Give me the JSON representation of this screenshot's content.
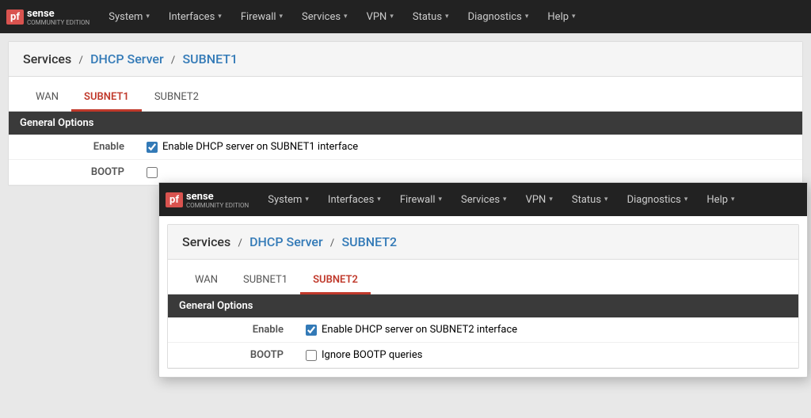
{
  "brand": {
    "pf": "pf",
    "sense": "sense",
    "sub": "COMMUNITY EDITION"
  },
  "nav": {
    "items": [
      {
        "label": "System",
        "has_arrow": true
      },
      {
        "label": "Interfaces",
        "has_arrow": true
      },
      {
        "label": "Firewall",
        "has_arrow": true
      },
      {
        "label": "Services",
        "has_arrow": true
      },
      {
        "label": "VPN",
        "has_arrow": true
      },
      {
        "label": "Status",
        "has_arrow": true
      },
      {
        "label": "Diagnostics",
        "has_arrow": true
      },
      {
        "label": "Help",
        "has_arrow": true
      }
    ]
  },
  "window1": {
    "breadcrumb": {
      "part1": "Services",
      "sep1": "/",
      "part2": "DHCP Server",
      "sep2": "/",
      "part3": "SUBNET1"
    },
    "tabs": [
      {
        "label": "WAN",
        "active": false
      },
      {
        "label": "SUBNET1",
        "active": true
      },
      {
        "label": "SUBNET2",
        "active": false
      }
    ],
    "section": "General Options",
    "fields": [
      {
        "label": "Enable",
        "type": "checkbox",
        "checked": true,
        "text": "Enable DHCP server on SUBNET1 interface"
      },
      {
        "label": "BOOTP",
        "type": "checkbox",
        "checked": false,
        "text": ""
      }
    ]
  },
  "window2": {
    "breadcrumb": {
      "part1": "Services",
      "sep1": "/",
      "part2": "DHCP Server",
      "sep2": "/",
      "part3": "SUBNET2"
    },
    "tabs": [
      {
        "label": "WAN",
        "active": false
      },
      {
        "label": "SUBNET1",
        "active": false
      },
      {
        "label": "SUBNET2",
        "active": true
      }
    ],
    "section": "General Options",
    "fields": [
      {
        "label": "Enable",
        "type": "checkbox",
        "checked": true,
        "text": "Enable DHCP server on SUBNET2 interface"
      },
      {
        "label": "BOOTP",
        "type": "checkbox",
        "checked": false,
        "text": "Ignore BOOTP queries"
      }
    ]
  }
}
